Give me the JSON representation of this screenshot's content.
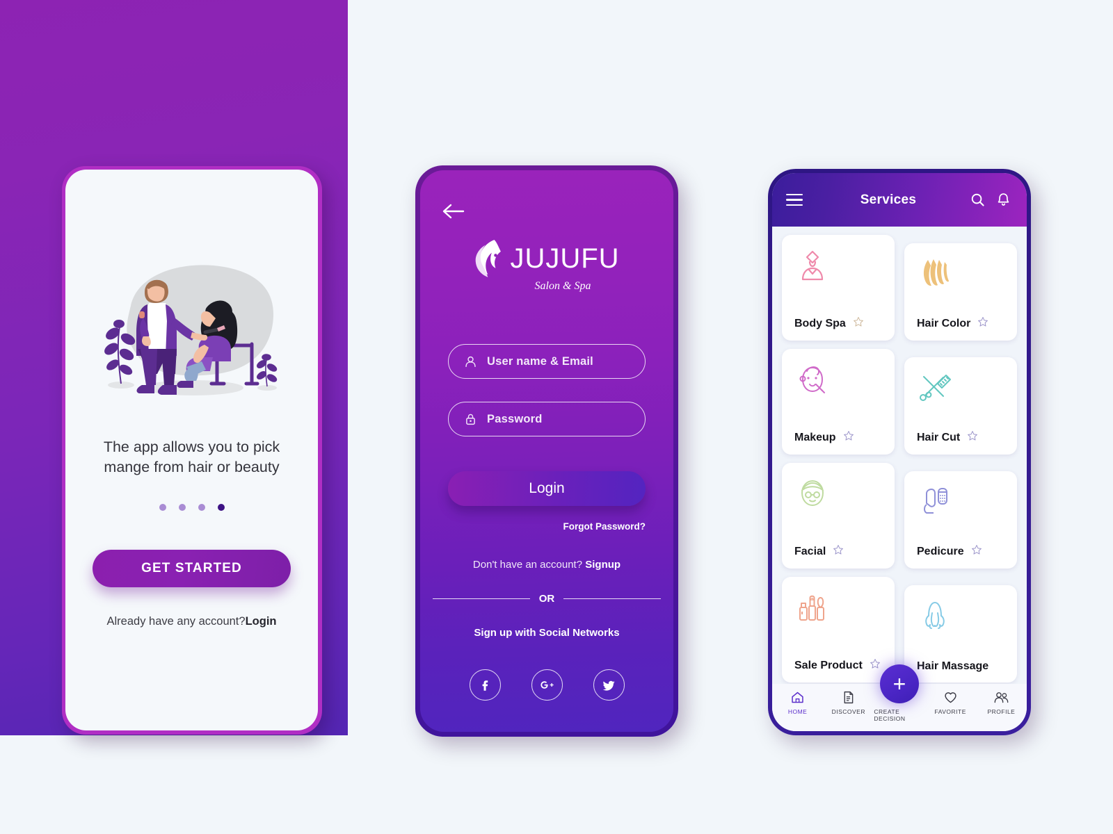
{
  "onboarding": {
    "headline": "The app allows you to pick mange from hair or beauty",
    "dots_total": 4,
    "active_dot_index": 3,
    "get_started_label": "GET STARTED",
    "already_prefix": "Already have any account?",
    "already_link": "Login",
    "illustration_name": "makeup-artist-illustration"
  },
  "login": {
    "back_icon": "back-arrow-icon",
    "logo_word": "JUJUFU",
    "logo_tagline": "Salon & Spa",
    "username_placeholder": "User name & Email",
    "username_value": "",
    "password_placeholder": "Password",
    "password_value": "",
    "login_label": "Login",
    "forgot_label": "Forgot Password?",
    "signup_prefix": "Don't have an account? ",
    "signup_link": "Signup",
    "or_label": "OR",
    "social_title": "Sign up with Social Networks",
    "social": [
      {
        "name": "facebook",
        "glyph": "f"
      },
      {
        "name": "google-plus",
        "glyph": "g+"
      },
      {
        "name": "twitter",
        "glyph": "twitter-bird"
      }
    ]
  },
  "services": {
    "title": "Services",
    "menu_icon": "hamburger-menu-icon",
    "search_icon": "search-icon",
    "notification_icon": "bell-icon",
    "cards": [
      {
        "label": "Body Spa",
        "icon": "body-spa-icon",
        "color": "#ef8aab",
        "favorited": false
      },
      {
        "label": "Hair Color",
        "icon": "hair-color-icon",
        "color": "#edc17a",
        "favorited": false
      },
      {
        "label": "Makeup",
        "icon": "makeup-face-icon",
        "color": "#d06bc9",
        "favorited": false
      },
      {
        "label": "Hair Cut",
        "icon": "scissors-comb-icon",
        "color": "#62c7c0",
        "favorited": false
      },
      {
        "label": "Facial",
        "icon": "facial-mask-icon",
        "color": "#bfdba0",
        "favorited": false
      },
      {
        "label": "Pedicure",
        "icon": "nail-polish-icon",
        "color": "#8f90d8",
        "favorited": false
      },
      {
        "label": "Sale Product",
        "icon": "cosmetics-icon",
        "color": "#efa48c",
        "favorited": false
      },
      {
        "label": "Hair Massage",
        "icon": "hair-massage-icon",
        "color": "#87cbe6",
        "favorited": false
      }
    ],
    "bottom_nav": [
      {
        "label": "HOME",
        "icon": "home-icon",
        "active": true
      },
      {
        "label": "DISCOVER",
        "icon": "document-icon",
        "active": false
      },
      {
        "label": "CREATE DECISION",
        "icon": "plus-icon",
        "active": false
      },
      {
        "label": "FAVORITE",
        "icon": "heart-icon",
        "active": false
      },
      {
        "label": "PROFILE",
        "icon": "people-icon",
        "active": false
      }
    ]
  },
  "theme": {
    "panel_purple": "#8a25b5",
    "accent_indigo": "#3a1f9e",
    "page_background": "#f2f6fa"
  }
}
